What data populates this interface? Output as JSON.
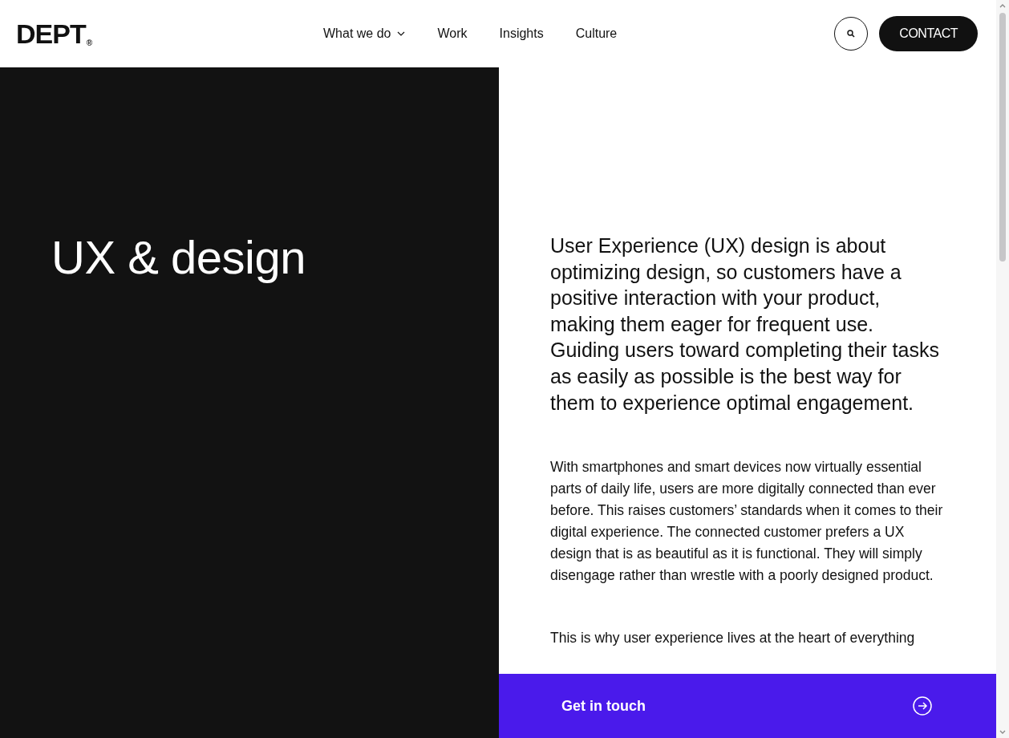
{
  "header": {
    "logo": "DEPT",
    "logo_mark": "®",
    "nav": [
      {
        "label": "What we do",
        "dropdown": true
      },
      {
        "label": "Work",
        "dropdown": false
      },
      {
        "label": "Insights",
        "dropdown": false
      },
      {
        "label": "Culture",
        "dropdown": false
      }
    ],
    "contact_button": "CONTACT"
  },
  "hero": {
    "title": "UX & design"
  },
  "content": {
    "lead": "User Experience (UX) design is about optimizing design, so customers have a positive interaction with your product, making them eager for frequent use. Guiding users toward completing their tasks as easily as possible is the best way for them to experience optimal engagement.",
    "paragraphs": [
      "With smartphones and smart devices now virtually essential parts of daily life, users are more digitally connected than ever before. This raises customers’ standards when it comes to their digital experience. The connected customer prefers a UX design that is as beautiful as it is functional. They will simply disengage rather than wrestle with a poorly designed product.",
      "This is why user experience lives at the heart of everything"
    ]
  },
  "cta": {
    "label": "Get in touch"
  }
}
